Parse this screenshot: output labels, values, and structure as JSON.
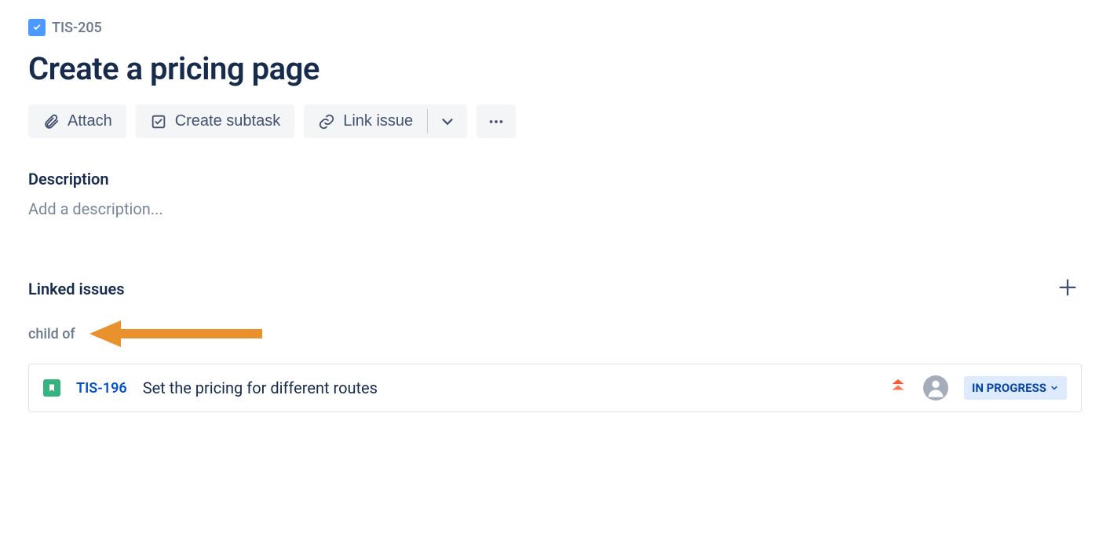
{
  "breadcrumb": {
    "key": "TIS-205"
  },
  "title": "Create a pricing page",
  "toolbar": {
    "attach_label": "Attach",
    "subtask_label": "Create subtask",
    "link_label": "Link issue"
  },
  "description": {
    "heading": "Description",
    "placeholder": "Add a description..."
  },
  "linked": {
    "heading": "Linked issues",
    "relation": "child of",
    "issue": {
      "key": "TIS-196",
      "summary": "Set the pricing for different routes",
      "status": "IN PROGRESS"
    }
  }
}
